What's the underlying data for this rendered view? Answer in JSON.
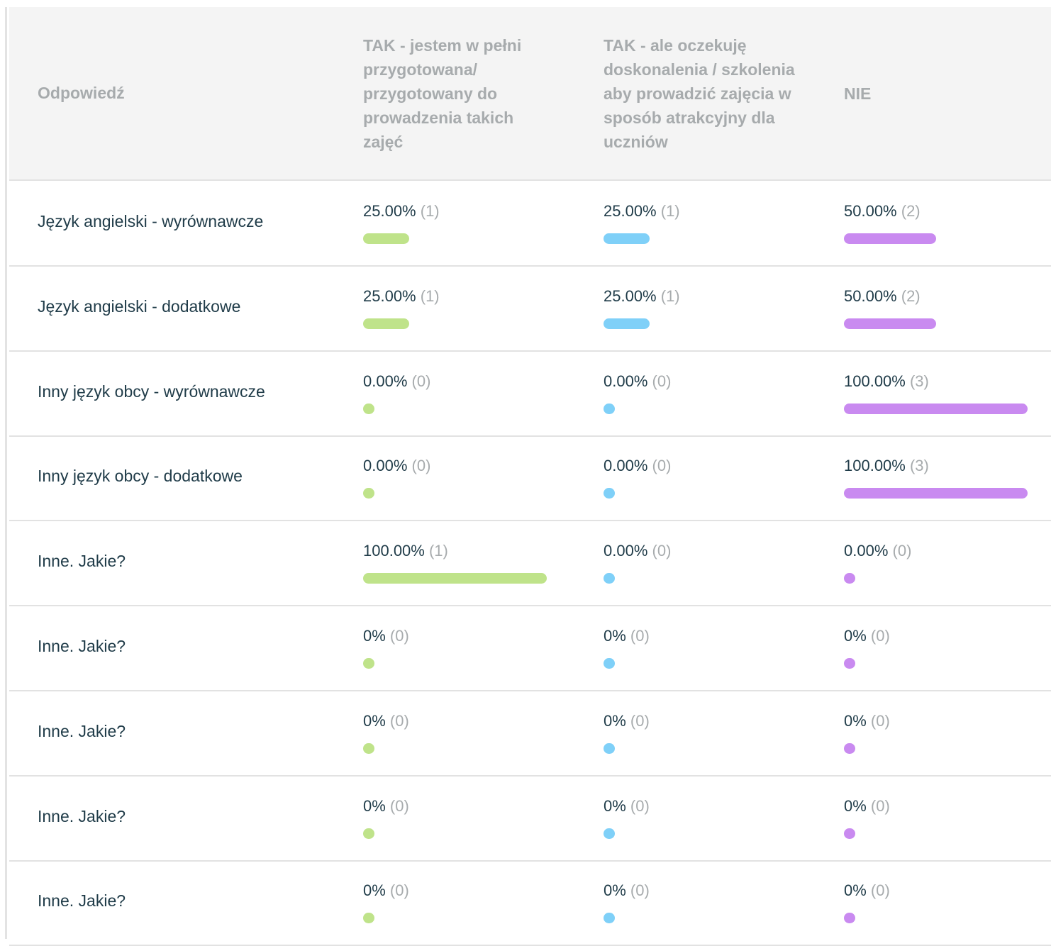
{
  "header": {
    "answer": "Odpowiedź",
    "options": [
      "TAK - jestem w pełni przygotowana/ przygotowany do prowadzenia takich zajęć",
      "TAK - ale oczekuję doskonalenia / szkolenia aby prowadzić zajęcia w sposób atrakcyjny dla uczniów",
      "NIE"
    ]
  },
  "colors": {
    "option_0": "#bfe38a",
    "option_1": "#7fd0f8",
    "option_2": "#c98af0"
  },
  "rows": [
    {
      "label": "Język angielski - wyrównawcze",
      "cells": [
        {
          "pct": "25.00%",
          "count": "(1)",
          "share": 0.25
        },
        {
          "pct": "25.00%",
          "count": "(1)",
          "share": 0.25
        },
        {
          "pct": "50.00%",
          "count": "(2)",
          "share": 0.5
        }
      ]
    },
    {
      "label": "Język angielski - dodatkowe",
      "cells": [
        {
          "pct": "25.00%",
          "count": "(1)",
          "share": 0.25
        },
        {
          "pct": "25.00%",
          "count": "(1)",
          "share": 0.25
        },
        {
          "pct": "50.00%",
          "count": "(2)",
          "share": 0.5
        }
      ]
    },
    {
      "label": "Inny język obcy - wyrównawcze",
      "cells": [
        {
          "pct": "0.00%",
          "count": "(0)",
          "share": 0
        },
        {
          "pct": "0.00%",
          "count": "(0)",
          "share": 0
        },
        {
          "pct": "100.00%",
          "count": "(3)",
          "share": 1
        }
      ]
    },
    {
      "label": "Inny język obcy - dodatkowe",
      "cells": [
        {
          "pct": "0.00%",
          "count": "(0)",
          "share": 0
        },
        {
          "pct": "0.00%",
          "count": "(0)",
          "share": 0
        },
        {
          "pct": "100.00%",
          "count": "(3)",
          "share": 1
        }
      ]
    },
    {
      "label": "Inne. Jakie?",
      "cells": [
        {
          "pct": "100.00%",
          "count": "(1)",
          "share": 1
        },
        {
          "pct": "0.00%",
          "count": "(0)",
          "share": 0
        },
        {
          "pct": "0.00%",
          "count": "(0)",
          "share": 0
        }
      ]
    },
    {
      "label": "Inne. Jakie?",
      "cells": [
        {
          "pct": "0%",
          "count": "(0)",
          "share": 0
        },
        {
          "pct": "0%",
          "count": "(0)",
          "share": 0
        },
        {
          "pct": "0%",
          "count": "(0)",
          "share": 0
        }
      ]
    },
    {
      "label": "Inne. Jakie?",
      "cells": [
        {
          "pct": "0%",
          "count": "(0)",
          "share": 0
        },
        {
          "pct": "0%",
          "count": "(0)",
          "share": 0
        },
        {
          "pct": "0%",
          "count": "(0)",
          "share": 0
        }
      ]
    },
    {
      "label": "Inne. Jakie?",
      "cells": [
        {
          "pct": "0%",
          "count": "(0)",
          "share": 0
        },
        {
          "pct": "0%",
          "count": "(0)",
          "share": 0
        },
        {
          "pct": "0%",
          "count": "(0)",
          "share": 0
        }
      ]
    },
    {
      "label": "Inne. Jakie?",
      "cells": [
        {
          "pct": "0%",
          "count": "(0)",
          "share": 0
        },
        {
          "pct": "0%",
          "count": "(0)",
          "share": 0
        },
        {
          "pct": "0%",
          "count": "(0)",
          "share": 0
        }
      ]
    }
  ]
}
